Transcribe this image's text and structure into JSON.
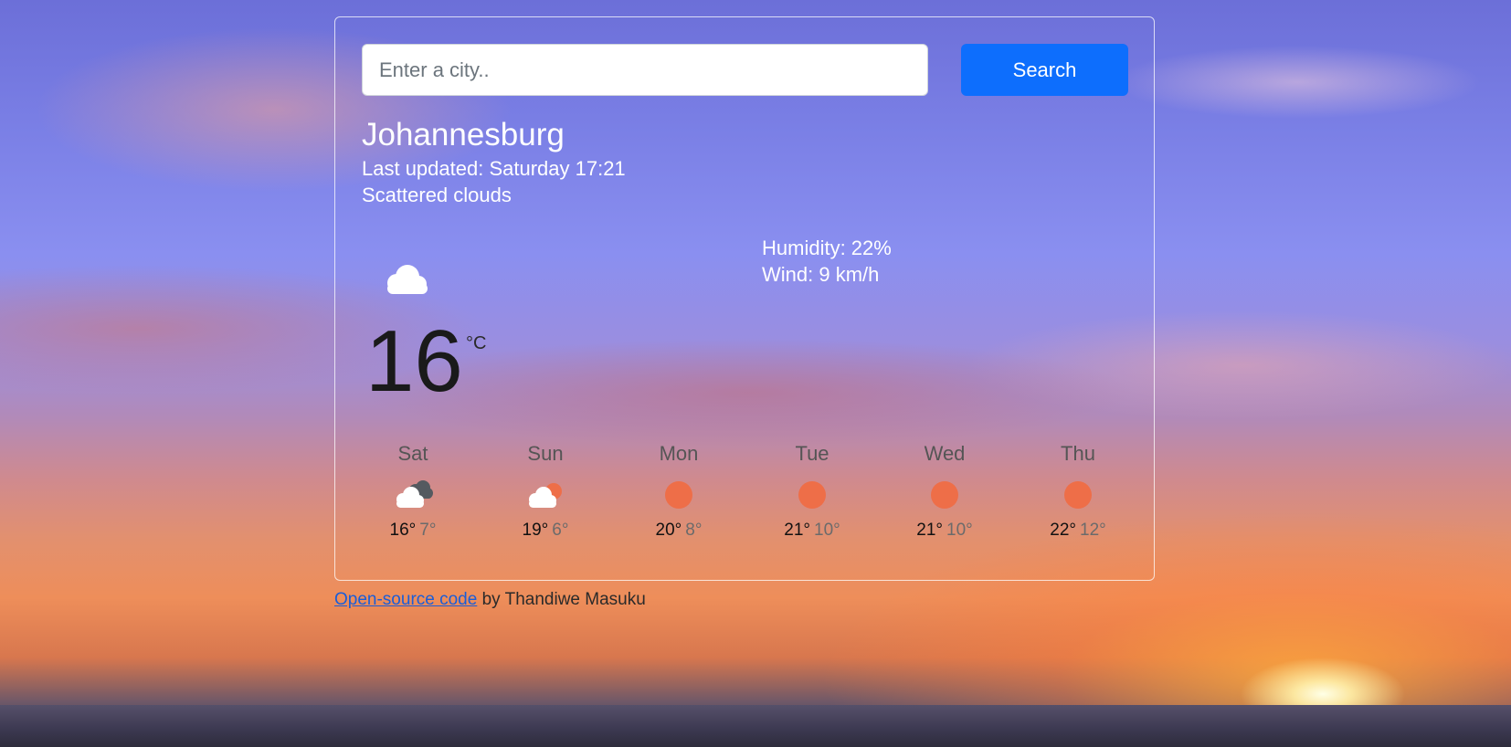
{
  "search": {
    "placeholder": "Enter a city..",
    "value": "",
    "button_label": "Search"
  },
  "current": {
    "city": "Johannesburg",
    "last_updated": "Last updated: Saturday 17:21",
    "condition": "Scattered clouds",
    "icon": "scattered-clouds-icon",
    "temperature": "16",
    "unit": "°C",
    "humidity": "Humidity: 22%",
    "wind": "Wind: 9 km/h"
  },
  "forecast": [
    {
      "day": "Sat",
      "max": "16°",
      "min": "7°",
      "icon": "broken-clouds-icon"
    },
    {
      "day": "Sun",
      "max": "19°",
      "min": "6°",
      "icon": "few-clouds-icon"
    },
    {
      "day": "Mon",
      "max": "20°",
      "min": "8°",
      "icon": "clear-sky-icon"
    },
    {
      "day": "Tue",
      "max": "21°",
      "min": "10°",
      "icon": "clear-sky-icon"
    },
    {
      "day": "Wed",
      "max": "21°",
      "min": "10°",
      "icon": "clear-sky-icon"
    },
    {
      "day": "Thu",
      "max": "22°",
      "min": "12°",
      "icon": "clear-sky-icon"
    }
  ],
  "footer": {
    "link_text": "Open-source code",
    "by_text": " by Thandiwe Masuku"
  },
  "colors": {
    "button": "#0d6efd",
    "sun": "#ee6e48"
  }
}
